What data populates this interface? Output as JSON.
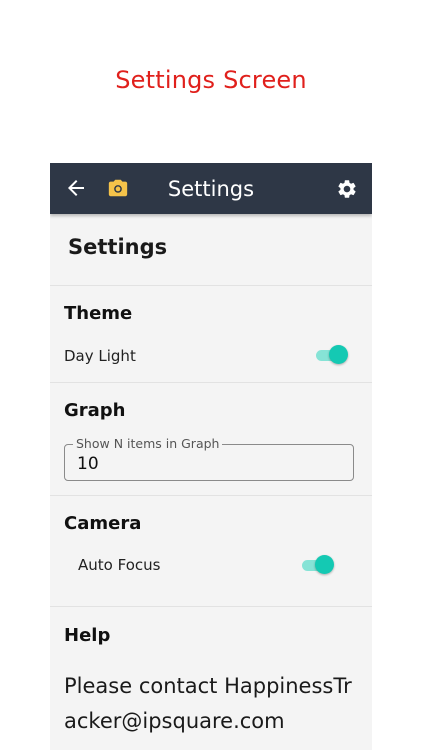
{
  "caption": "Settings Screen",
  "appbar": {
    "title": "Settings",
    "back_icon": "arrow-left-icon",
    "camera_icon": "camera-icon",
    "settings_icon": "gear-icon",
    "background": "#2e3746",
    "camera_color": "#f5c34a"
  },
  "page": {
    "heading": "Settings"
  },
  "theme": {
    "title": "Theme",
    "option_label": "Day Light",
    "enabled": true
  },
  "graph": {
    "title": "Graph",
    "field_label": "Show N items in Graph",
    "field_value": "10"
  },
  "camera": {
    "title": "Camera",
    "option_label": "Auto Focus",
    "enabled": true
  },
  "help": {
    "title": "Help",
    "text": "Please contact HappinessTracker@ipsquare.com"
  },
  "colors": {
    "caption": "#e0201c",
    "toggle_on": "#14c9b3"
  }
}
